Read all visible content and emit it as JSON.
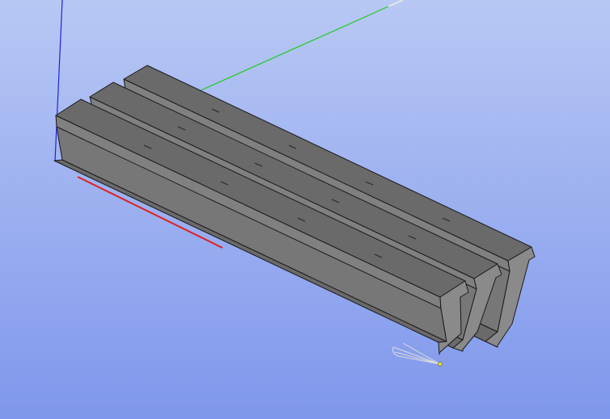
{
  "viewport": {
    "background_top": "#b8c8f4",
    "background_bottom": "#7f97ec",
    "beam_face_color": "#777777",
    "beam_top_color": "#6a6a6a",
    "beam_end_color": "#8a8a8a",
    "edge_color": "#1a1a1a",
    "axes": [
      {
        "name": "x-axis",
        "color": "#dd2222"
      },
      {
        "name": "y-axis",
        "color": "#22cc22"
      },
      {
        "name": "z-axis",
        "color": "#2222dd"
      }
    ],
    "beams": [
      {
        "name": "i-beam-front"
      },
      {
        "name": "i-beam-middle"
      },
      {
        "name": "i-beam-back"
      }
    ],
    "light_marker_icon": "light-icon"
  }
}
